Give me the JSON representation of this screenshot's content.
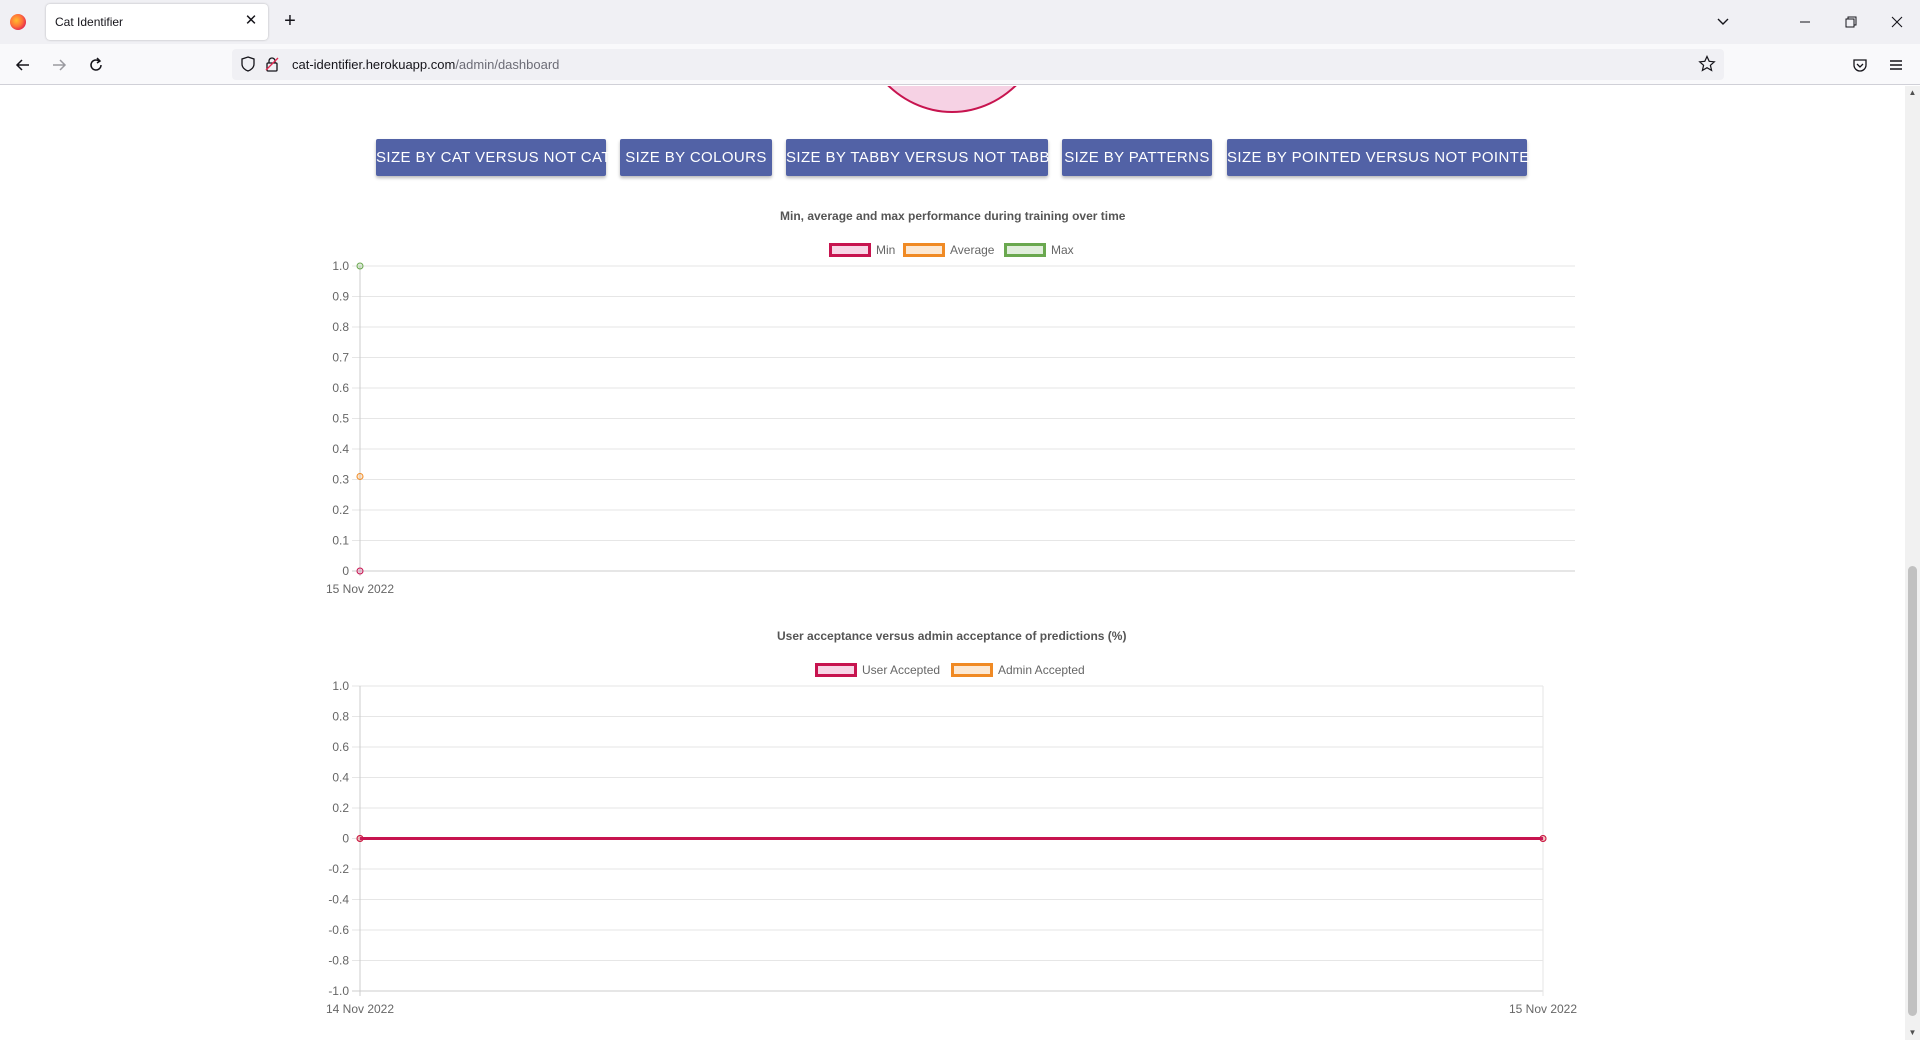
{
  "browser": {
    "tab_title": "Cat Identifier",
    "tab_close_glyph": "✕",
    "new_tab_glyph": "+",
    "url_host": "cat-identifier.herokuapp.com",
    "url_path": "/admin/dashboard",
    "icons": [
      "firefox-logo-icon",
      "close-icon",
      "plus-icon",
      "chevron-down-icon",
      "minimize-icon",
      "restore-icon",
      "close-window-icon",
      "back-arrow-icon",
      "forward-arrow-icon",
      "reload-icon",
      "shield-icon",
      "lock-icon",
      "star-icon",
      "pocket-icon",
      "hamburger-menu-icon"
    ]
  },
  "buttons": {
    "cat": "SIZE BY CAT VERSUS NOT CAT",
    "colours": "SIZE BY COLOURS",
    "tabby": "SIZE BY TABBY VERSUS NOT TABBY",
    "patterns": "SIZE BY PATTERNS",
    "pointed": "SIZE BY POINTED VERSUS NOT POINTED"
  },
  "colors": {
    "button_bg": "#5262a6",
    "min": "#c7144f",
    "average": "#f08a24",
    "max": "#6aa84f",
    "pie_fill": "#f2c6d8"
  },
  "chart_data": [
    {
      "type": "line",
      "title": "Min, average and max performance during training over time",
      "x": [
        "15 Nov 2022"
      ],
      "series": [
        {
          "name": "Min",
          "values": [
            0
          ]
        },
        {
          "name": "Average",
          "values": [
            0.31
          ]
        },
        {
          "name": "Max",
          "values": [
            1.0
          ]
        }
      ],
      "y_ticks": [
        "1.0",
        "0.9",
        "0.8",
        "0.7",
        "0.6",
        "0.5",
        "0.4",
        "0.3",
        "0.2",
        "0.1",
        "0"
      ],
      "ylim": [
        0,
        1.0
      ],
      "grid": true,
      "legend": "top"
    },
    {
      "type": "line",
      "title": "User acceptance versus admin acceptance of predictions (%)",
      "x": [
        "14 Nov 2022",
        "15 Nov 2022"
      ],
      "series": [
        {
          "name": "User Accepted",
          "values": [
            0,
            0
          ]
        },
        {
          "name": "Admin Accepted",
          "values": [
            0,
            0
          ]
        }
      ],
      "y_ticks": [
        "1.0",
        "0.8",
        "0.6",
        "0.4",
        "0.2",
        "0",
        "-0.2",
        "-0.4",
        "-0.6",
        "-0.8",
        "-1.0"
      ],
      "ylim": [
        -1.0,
        1.0
      ],
      "grid": true,
      "legend": "top"
    }
  ]
}
